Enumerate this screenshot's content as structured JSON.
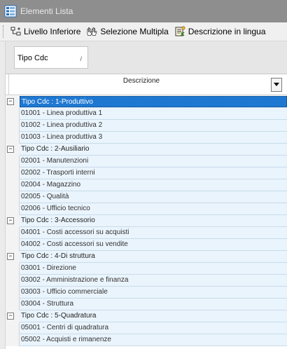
{
  "window": {
    "title": "Elementi Lista",
    "icon": "list-grid-icon"
  },
  "toolbar": {
    "buttons": [
      {
        "label": "Livello Inferiore",
        "icon": "tree-level-icon"
      },
      {
        "label": "Selezione Multipla",
        "icon": "multi-select-icon"
      },
      {
        "label": "Descrizione in lingua",
        "icon": "language-description-icon"
      }
    ]
  },
  "group_panel": {
    "chip_label": "Tipo Cdc",
    "sort_indicator": "/"
  },
  "grid": {
    "column_header": "Descrizione",
    "groups": [
      {
        "label": "Tipo Cdc : 1-Produttivo",
        "expander": "−",
        "selected": true,
        "items": [
          "01001 - Linea produttiva 1",
          "01002 - Linea produttiva 2",
          "01003 - Linea produttiva 3"
        ]
      },
      {
        "label": "Tipo Cdc : 2-Ausiliario",
        "expander": "−",
        "selected": false,
        "items": [
          "02001 - Manutenzioni",
          "02002 - Trasporti interni",
          "02004 - Magazzino",
          "02005 - Qualità",
          "02006 - Ufficio tecnico"
        ]
      },
      {
        "label": "Tipo Cdc : 3-Accessorio",
        "expander": "−",
        "selected": false,
        "items": [
          "04001 - Costi accessori su acquisti",
          "04002 - Costi accessori su vendite"
        ]
      },
      {
        "label": "Tipo Cdc : 4-Di struttura",
        "expander": "−",
        "selected": false,
        "items": [
          "03001 - Direzione",
          "03002 - Amministrazione e finanza",
          "03003 - Ufficio commerciale",
          "03004 - Struttura"
        ]
      },
      {
        "label": "Tipo Cdc : 5-Quadratura",
        "expander": "−",
        "selected": false,
        "items": [
          "05001 - Centri di quadratura",
          "05002 - Acquisti e rimanenze"
        ]
      }
    ]
  }
}
